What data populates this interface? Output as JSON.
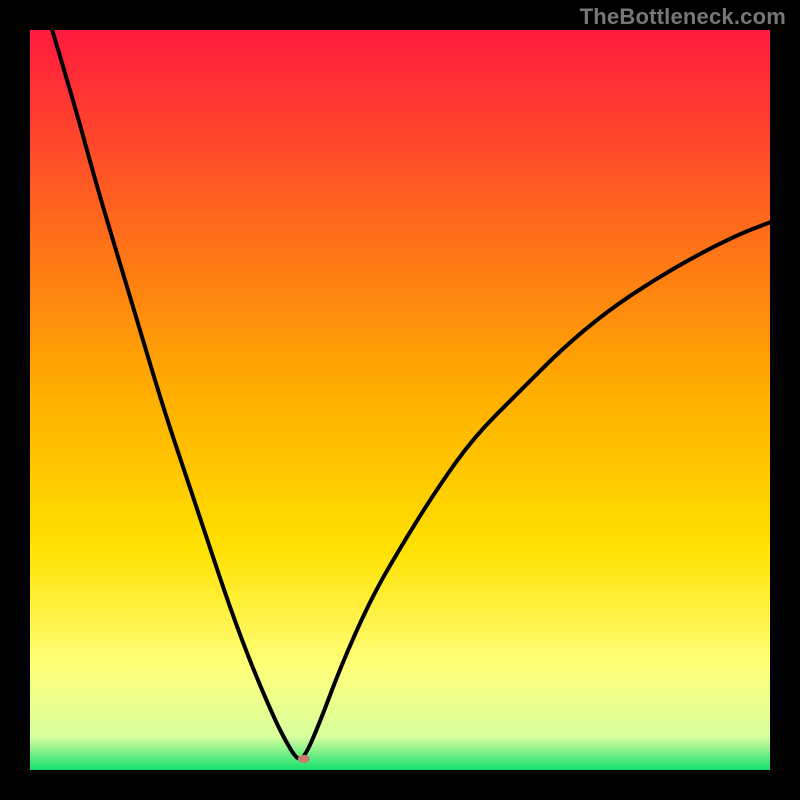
{
  "watermark": "TheBottleneck.com",
  "chart_data": {
    "type": "line",
    "title": "",
    "xlabel": "",
    "ylabel": "",
    "xlim": [
      0,
      100
    ],
    "ylim": [
      0,
      100
    ],
    "background_gradient": {
      "top_color": "#ff1a3e",
      "mid_color": "#ffd400",
      "lower_color": "#ffff7a",
      "bottom_color": "#16e06f"
    },
    "curve": {
      "name": "bottleneck-curve",
      "color": "#000000",
      "x": [
        3,
        6,
        9,
        12,
        15,
        18,
        21,
        24,
        27,
        30,
        33,
        34.5,
        36,
        37,
        39,
        42,
        46,
        50,
        55,
        60,
        66,
        72,
        78,
        84,
        90,
        96,
        100
      ],
      "y": [
        100,
        90,
        79,
        69,
        59,
        49,
        40,
        31,
        22,
        14,
        7,
        4,
        1.5,
        1.5,
        6,
        14,
        23,
        30,
        38,
        45,
        51,
        57,
        62,
        66,
        69.5,
        72.5,
        74
      ]
    },
    "minimum_marker": {
      "x": 37,
      "y": 1.5,
      "color": "#c87a6e",
      "rx": 6,
      "ry": 4
    }
  }
}
